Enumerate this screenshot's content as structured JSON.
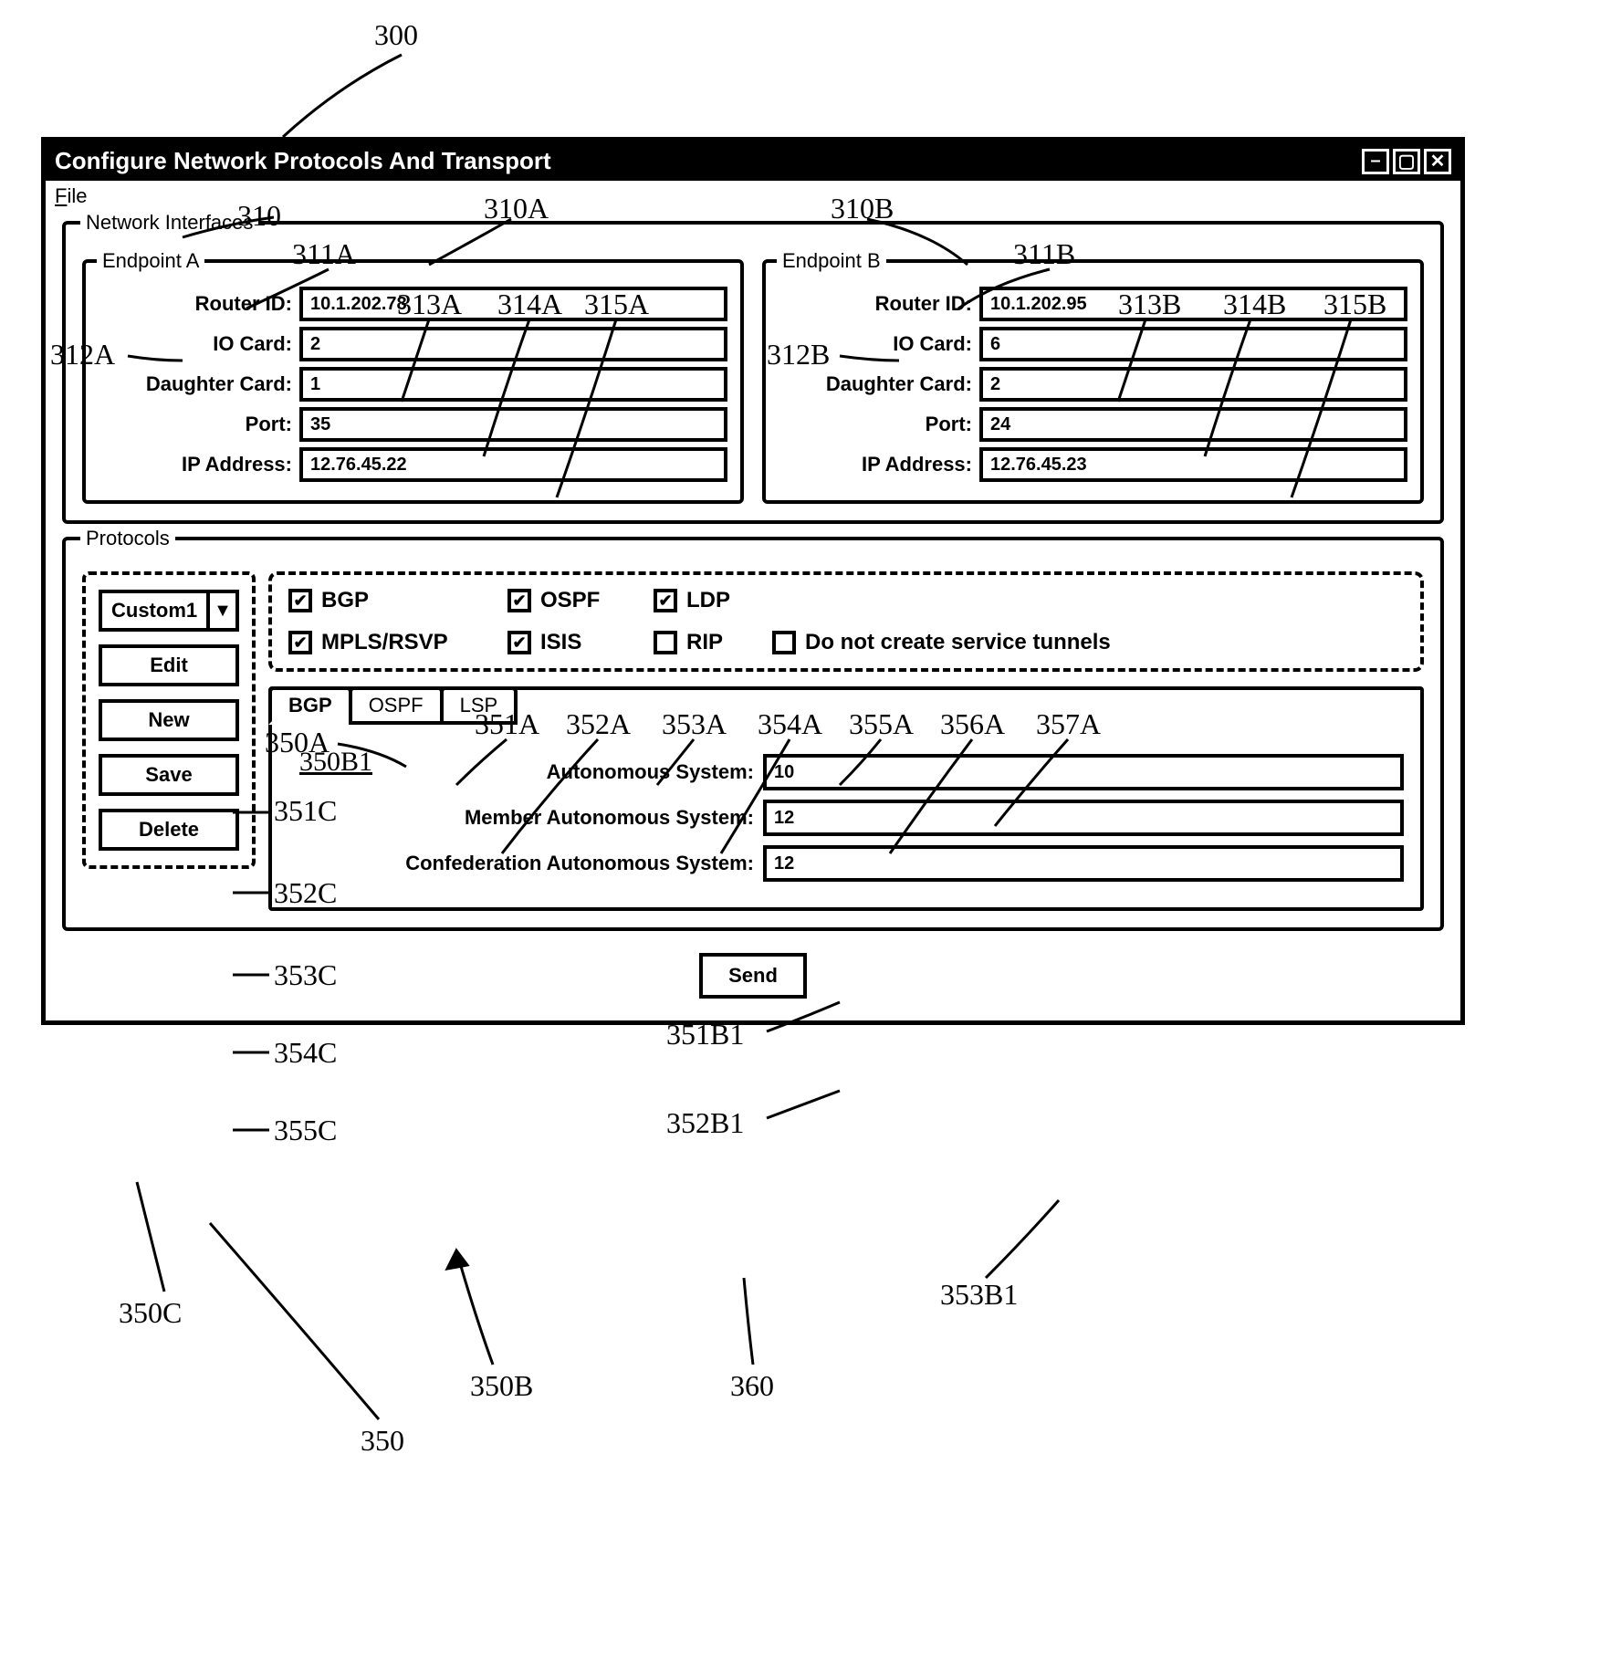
{
  "window": {
    "title": "Configure Network Protocols And Transport"
  },
  "menubar": {
    "file": "File",
    "file_mnemonic": "F"
  },
  "fieldsets": {
    "network_interfaces": "Network Interfaces",
    "protocols": "Protocols"
  },
  "endpoints": {
    "a": {
      "legend": "Endpoint A",
      "router_id_label": "Router ID:",
      "router_id": "10.1.202.78",
      "io_card_label": "IO Card:",
      "io_card": "2",
      "daughter_card_label": "Daughter Card:",
      "daughter_card": "1",
      "port_label": "Port:",
      "port": "35",
      "ip_label": "IP Address:",
      "ip": "12.76.45.22"
    },
    "b": {
      "legend": "Endpoint B",
      "router_id_label": "Router ID:",
      "router_id": "10.1.202.95",
      "io_card_label": "IO Card:",
      "io_card": "6",
      "daughter_card_label": "Daughter Card:",
      "daughter_card": "2",
      "port_label": "Port:",
      "port": "24",
      "ip_label": "IP Address:",
      "ip": "12.76.45.23"
    }
  },
  "profile": {
    "selected": "Custom1",
    "buttons": {
      "edit": "Edit",
      "new": "New",
      "save": "Save",
      "delete": "Delete"
    }
  },
  "protocol_checks": {
    "bgp": {
      "label": "BGP",
      "checked": true
    },
    "ospf": {
      "label": "OSPF",
      "checked": true
    },
    "ldp": {
      "label": "LDP",
      "checked": true
    },
    "no_tunnels": {
      "label": "Do not create service tunnels",
      "checked": false
    },
    "mpls": {
      "label": "MPLS/RSVP",
      "checked": true
    },
    "isis": {
      "label": "ISIS",
      "checked": true
    },
    "rip": {
      "label": "RIP",
      "checked": false
    }
  },
  "tabs": {
    "bgp": "BGP",
    "ospf": "OSPF",
    "lsp": "LSP"
  },
  "bgp_tab": {
    "autonomous_system_label": "Autonomous System:",
    "autonomous_system": "10",
    "member_as_label": "Member Autonomous System:",
    "member_as": "12",
    "confed_as_label": "Confederation Autonomous System:",
    "confed_as": "12"
  },
  "send": "Send",
  "callouts": {
    "300": "300",
    "310": "310",
    "310A": "310A",
    "310B": "310B",
    "311A": "311A",
    "311B": "311B",
    "312A": "312A",
    "312B": "312B",
    "313A": "313A",
    "313B": "313B",
    "314A": "314A",
    "314B": "314B",
    "315A": "315A",
    "315B": "315B",
    "350": "350",
    "350A": "350A",
    "350B": "350B",
    "350B1": "350B1",
    "350C": "350C",
    "351A": "351A",
    "351B1": "351B1",
    "351C": "351C",
    "352A": "352A",
    "352B1": "352B1",
    "352C": "352C",
    "353A": "353A",
    "353B1": "353B1",
    "353C": "353C",
    "354A": "354A",
    "354C": "354C",
    "355A": "355A",
    "355C": "355C",
    "356A": "356A",
    "357A": "357A",
    "360": "360"
  }
}
